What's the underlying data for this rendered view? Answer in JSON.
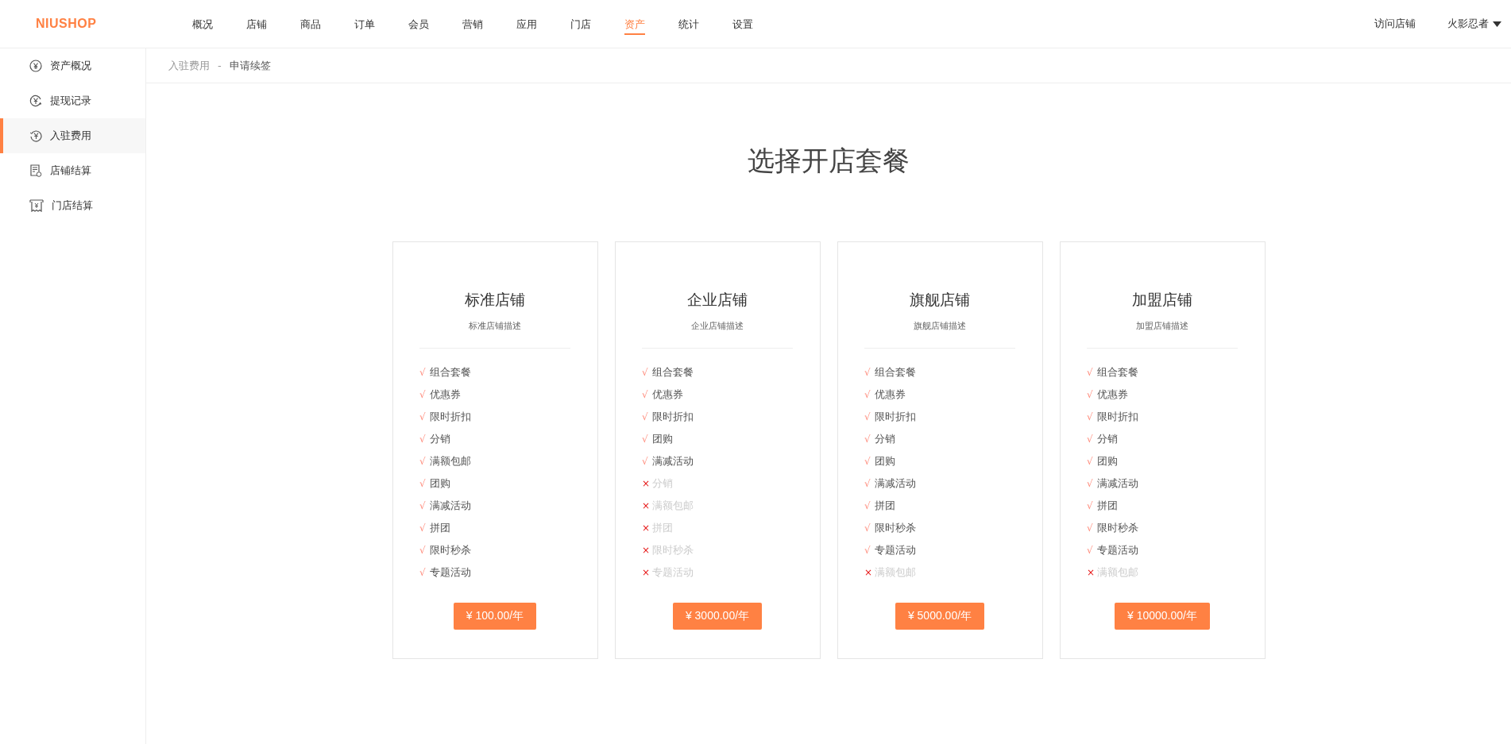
{
  "header": {
    "logo": "NIUSHOP",
    "nav": [
      {
        "label": "概况",
        "selected": false
      },
      {
        "label": "店铺",
        "selected": false
      },
      {
        "label": "商品",
        "selected": false
      },
      {
        "label": "订单",
        "selected": false
      },
      {
        "label": "会员",
        "selected": false
      },
      {
        "label": "营销",
        "selected": false
      },
      {
        "label": "应用",
        "selected": false
      },
      {
        "label": "门店",
        "selected": false
      },
      {
        "label": "资产",
        "selected": true
      },
      {
        "label": "统计",
        "selected": false
      },
      {
        "label": "设置",
        "selected": false
      }
    ],
    "visit_store": "访问店铺",
    "user": "火影忍者"
  },
  "sidebar": {
    "items": [
      {
        "label": "资产概况",
        "kind": "overview",
        "selected": false
      },
      {
        "label": "提现记录",
        "kind": "withdrawal",
        "selected": false
      },
      {
        "label": "入驻费用",
        "kind": "fee",
        "selected": true
      },
      {
        "label": "店铺结算",
        "kind": "store",
        "selected": false
      },
      {
        "label": "门店结算",
        "kind": "branch",
        "selected": false
      }
    ]
  },
  "breadcrumb": {
    "parent": "入驻费用",
    "separator": "-",
    "current": "申请续签"
  },
  "title": "选择开店套餐",
  "plans": [
    {
      "name": "标准店铺",
      "description": "标准店铺描述",
      "price": "¥ 100.00/年",
      "features": [
        {
          "mark": "√",
          "label": "组合套餐",
          "included": true
        },
        {
          "mark": "√",
          "label": "优惠券",
          "included": true
        },
        {
          "mark": "√",
          "label": "限时折扣",
          "included": true
        },
        {
          "mark": "√",
          "label": "分销",
          "included": true
        },
        {
          "mark": "√",
          "label": "满额包邮",
          "included": true
        },
        {
          "mark": "√",
          "label": "团购",
          "included": true
        },
        {
          "mark": "√",
          "label": "满减活动",
          "included": true
        },
        {
          "mark": "√",
          "label": "拼团",
          "included": true
        },
        {
          "mark": "√",
          "label": "限时秒杀",
          "included": true
        },
        {
          "mark": "√",
          "label": "专题活动",
          "included": true
        }
      ]
    },
    {
      "name": "企业店铺",
      "description": "企业店铺描述",
      "price": "¥ 3000.00/年",
      "features": [
        {
          "mark": "√",
          "label": "组合套餐",
          "included": true
        },
        {
          "mark": "√",
          "label": "优惠券",
          "included": true
        },
        {
          "mark": "√",
          "label": "限时折扣",
          "included": true
        },
        {
          "mark": "√",
          "label": "团购",
          "included": true
        },
        {
          "mark": "√",
          "label": "满减活动",
          "included": true
        },
        {
          "mark": "×",
          "label": "分销",
          "included": false
        },
        {
          "mark": "×",
          "label": "满额包邮",
          "included": false
        },
        {
          "mark": "×",
          "label": "拼团",
          "included": false
        },
        {
          "mark": "×",
          "label": "限时秒杀",
          "included": false
        },
        {
          "mark": "×",
          "label": "专题活动",
          "included": false
        }
      ]
    },
    {
      "name": "旗舰店铺",
      "description": "旗舰店铺描述",
      "price": "¥ 5000.00/年",
      "features": [
        {
          "mark": "√",
          "label": "组合套餐",
          "included": true
        },
        {
          "mark": "√",
          "label": "优惠券",
          "included": true
        },
        {
          "mark": "√",
          "label": "限时折扣",
          "included": true
        },
        {
          "mark": "√",
          "label": "分销",
          "included": true
        },
        {
          "mark": "√",
          "label": "团购",
          "included": true
        },
        {
          "mark": "√",
          "label": "满减活动",
          "included": true
        },
        {
          "mark": "√",
          "label": "拼团",
          "included": true
        },
        {
          "mark": "√",
          "label": "限时秒杀",
          "included": true
        },
        {
          "mark": "√",
          "label": "专题活动",
          "included": true
        },
        {
          "mark": "×",
          "label": "满额包邮",
          "included": false
        }
      ]
    },
    {
      "name": "加盟店铺",
      "description": "加盟店铺描述",
      "price": "¥ 10000.00/年",
      "features": [
        {
          "mark": "√",
          "label": "组合套餐",
          "included": true
        },
        {
          "mark": "√",
          "label": "优惠券",
          "included": true
        },
        {
          "mark": "√",
          "label": "限时折扣",
          "included": true
        },
        {
          "mark": "√",
          "label": "分销",
          "included": true
        },
        {
          "mark": "√",
          "label": "团购",
          "included": true
        },
        {
          "mark": "√",
          "label": "满减活动",
          "included": true
        },
        {
          "mark": "√",
          "label": "拼团",
          "included": true
        },
        {
          "mark": "√",
          "label": "限时秒杀",
          "included": true
        },
        {
          "mark": "√",
          "label": "专题活动",
          "included": true
        },
        {
          "mark": "×",
          "label": "满额包邮",
          "included": false
        }
      ]
    }
  ]
}
